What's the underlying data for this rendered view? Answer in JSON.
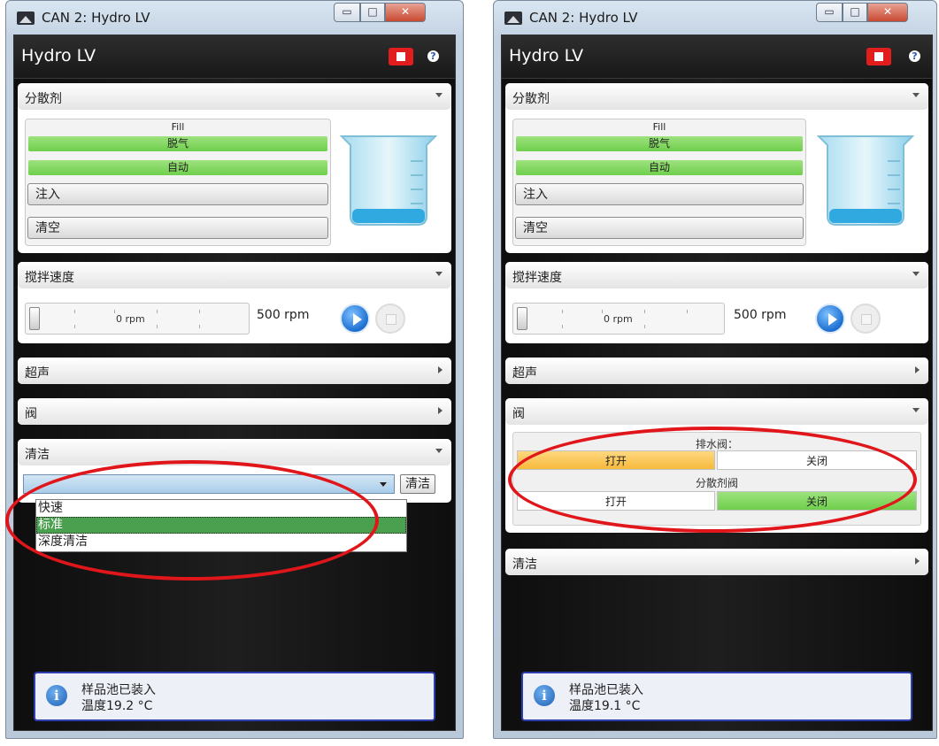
{
  "left": {
    "window_title": "CAN 2: Hydro LV",
    "header_title": "Hydro LV",
    "dispersant": {
      "label": "分散剂",
      "fill_label": "Fill",
      "degas": "脱气",
      "auto": "自动",
      "fill_button": "注入",
      "empty_button": "清空"
    },
    "stirrer": {
      "label": "搅拌速度",
      "min": "0 rpm",
      "value": "500 rpm"
    },
    "ultrasound": {
      "label": "超声"
    },
    "valves": {
      "label": "阀"
    },
    "clean": {
      "label": "清洁",
      "button": "清洁",
      "options": [
        "快速",
        "标准",
        "深度清洁"
      ],
      "selected_option": "标准"
    },
    "status": {
      "line1": "样品池已装入",
      "line2": "温度19.2 °C"
    }
  },
  "right": {
    "window_title": "CAN 2: Hydro LV",
    "header_title": "Hydro LV",
    "dispersant": {
      "label": "分散剂",
      "fill_label": "Fill",
      "degas": "脱气",
      "auto": "自动",
      "fill_button": "注入",
      "empty_button": "清空"
    },
    "stirrer": {
      "label": "搅拌速度",
      "min": "0 rpm",
      "value": "500 rpm"
    },
    "ultrasound": {
      "label": "超声"
    },
    "valves": {
      "label": "阀",
      "drain_label": "排水阀：",
      "drain_open": "打开",
      "drain_close": "关闭",
      "drain_state": "打开",
      "dispersant_label": "分散剂阀",
      "dispersant_open": "打开",
      "dispersant_close": "关闭",
      "dispersant_state": "关闭"
    },
    "clean": {
      "label": "清洁"
    },
    "status": {
      "line1": "样品池已装入",
      "line2": "温度19.1 °C"
    }
  },
  "colors": {
    "accent_green": "#6fcf4c",
    "active_orange": "#f6b93b",
    "stop_red": "#e21d1d",
    "annotation_red": "#e0161b"
  }
}
